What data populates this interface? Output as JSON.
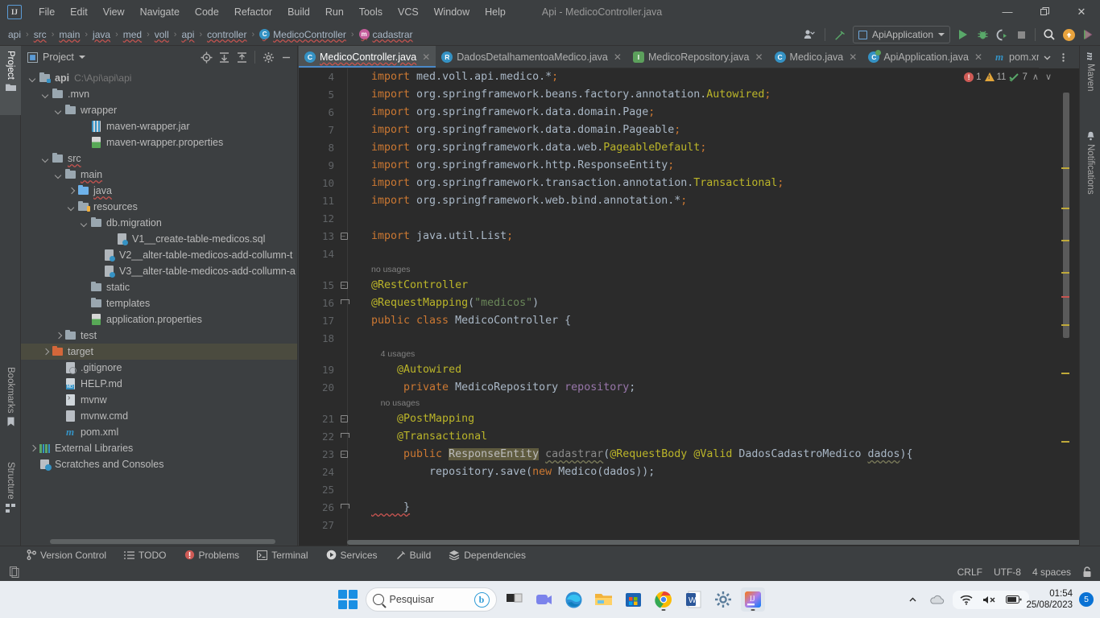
{
  "window": {
    "title": "Api - MedicoController.java",
    "logo": "IJ",
    "controls": {
      "minimize": "—",
      "maximize": "❐",
      "close": "✕"
    }
  },
  "menu": [
    {
      "label": "File"
    },
    {
      "label": "Edit"
    },
    {
      "label": "View"
    },
    {
      "label": "Navigate"
    },
    {
      "label": "Code"
    },
    {
      "label": "Refactor"
    },
    {
      "label": "Build"
    },
    {
      "label": "Run"
    },
    {
      "label": "Tools"
    },
    {
      "label": "VCS"
    },
    {
      "label": "Window"
    },
    {
      "label": "Help"
    }
  ],
  "breadcrumb": [
    {
      "label": "api",
      "icon": "none",
      "squiggle": false
    },
    {
      "label": "src",
      "icon": "none",
      "squiggle": true
    },
    {
      "label": "main",
      "icon": "none",
      "squiggle": true
    },
    {
      "label": "java",
      "icon": "none",
      "squiggle": true
    },
    {
      "label": "med",
      "icon": "none",
      "squiggle": true
    },
    {
      "label": "voll",
      "icon": "none",
      "squiggle": true
    },
    {
      "label": "api",
      "icon": "none",
      "squiggle": true
    },
    {
      "label": "controller",
      "icon": "none",
      "squiggle": true
    },
    {
      "label": "MedicoController",
      "icon": "class-icon",
      "squiggle": true
    },
    {
      "label": "cadastrar",
      "icon": "method-icon",
      "squiggle": true
    }
  ],
  "toolbar": {
    "run_config": "ApiApplication",
    "icons": [
      "user-settings-icon",
      "build-hammer-icon",
      "run-icon",
      "debug-icon",
      "run-with-coverage-icon",
      "stop-icon",
      "search-everywhere-icon",
      "update-project-icon",
      "ide-assistant-icon"
    ]
  },
  "left_strip": [
    {
      "label": "Project",
      "icon": "project-folder-icon",
      "active": true
    },
    {
      "label": "Bookmarks",
      "icon": "bookmark-icon",
      "active": false
    },
    {
      "label": "Structure",
      "icon": "structure-icon",
      "active": false
    }
  ],
  "right_strip": [
    {
      "label": "Maven",
      "icon": "maven-icon"
    },
    {
      "label": "Notifications",
      "icon": "bell-icon"
    }
  ],
  "project_panel": {
    "title": "Project",
    "tools": [
      "select-opened-file-icon",
      "expand-all-icon",
      "collapse-all-icon",
      "settings-gear-icon",
      "hide-panel-icon"
    ],
    "tree": [
      {
        "label": "api",
        "path": "C:\\Api\\api\\api",
        "depth": 0,
        "arrow": "d",
        "icon": "module-folder",
        "selected": false,
        "squiggle": false,
        "bold": true
      },
      {
        "label": ".mvn",
        "depth": 1,
        "arrow": "d",
        "icon": "folder",
        "selected": false
      },
      {
        "label": "wrapper",
        "depth": 2,
        "arrow": "d",
        "icon": "folder",
        "selected": false
      },
      {
        "label": "maven-wrapper.jar",
        "depth": 4,
        "arrow": "",
        "icon": "jar",
        "selected": false
      },
      {
        "label": "maven-wrapper.properties",
        "depth": 4,
        "arrow": "",
        "icon": "properties",
        "selected": false
      },
      {
        "label": "src",
        "depth": 1,
        "arrow": "d",
        "icon": "folder",
        "selected": false,
        "squiggle": true
      },
      {
        "label": "main",
        "depth": 2,
        "arrow": "d",
        "icon": "folder",
        "selected": false,
        "squiggle": true
      },
      {
        "label": "java",
        "depth": 3,
        "arrow": "r",
        "icon": "source-folder",
        "selected": false,
        "squiggle": true
      },
      {
        "label": "resources",
        "depth": 3,
        "arrow": "d",
        "icon": "resource-folder",
        "selected": false
      },
      {
        "label": "db.migration",
        "depth": 4,
        "arrow": "d",
        "icon": "folder",
        "selected": false
      },
      {
        "label": "V1__create-table-medicos.sql",
        "depth": 6,
        "arrow": "",
        "icon": "sql",
        "selected": false
      },
      {
        "label": "V2__alter-table-medicos-add-collumn-t",
        "depth": 5,
        "arrow": "",
        "icon": "sql",
        "selected": false
      },
      {
        "label": "V3__alter-table-medicos-add-collumn-a",
        "depth": 5,
        "arrow": "",
        "icon": "sql",
        "selected": false
      },
      {
        "label": "static",
        "depth": 4,
        "arrow": "",
        "icon": "folder",
        "selected": false
      },
      {
        "label": "templates",
        "depth": 4,
        "arrow": "",
        "icon": "folder",
        "selected": false
      },
      {
        "label": "application.properties",
        "depth": 4,
        "arrow": "",
        "icon": "properties",
        "selected": false
      },
      {
        "label": "test",
        "depth": 2,
        "arrow": "r",
        "icon": "folder",
        "selected": false
      },
      {
        "label": "target",
        "depth": 1,
        "arrow": "r",
        "icon": "target-folder",
        "selected": true
      },
      {
        "label": ".gitignore",
        "depth": 2,
        "arrow": "",
        "icon": "gitignore",
        "selected": false
      },
      {
        "label": "HELP.md",
        "depth": 2,
        "arrow": "",
        "icon": "markdown",
        "selected": false
      },
      {
        "label": "mvnw",
        "depth": 2,
        "arrow": "",
        "icon": "script",
        "selected": false
      },
      {
        "label": "mvnw.cmd",
        "depth": 2,
        "arrow": "",
        "icon": "file",
        "selected": false
      },
      {
        "label": "pom.xml",
        "depth": 2,
        "arrow": "",
        "icon": "maven-file",
        "selected": false
      },
      {
        "label": "External Libraries",
        "depth": 0,
        "arrow": "r",
        "icon": "libraries",
        "selected": false
      },
      {
        "label": "Scratches and Consoles",
        "depth": 0,
        "arrow": "",
        "icon": "scratches",
        "selected": false
      }
    ]
  },
  "editor_tabs": [
    {
      "label": "MedicoController.java",
      "icon": "class-file-icon",
      "active": true,
      "squiggle": true
    },
    {
      "label": "DadosDetalhamentoaMedico.java",
      "icon": "record-file-icon",
      "active": false,
      "squiggle": false
    },
    {
      "label": "MedicoRepository.java",
      "icon": "interface-file-icon",
      "active": false,
      "squiggle": false
    },
    {
      "label": "Medico.java",
      "icon": "class-file-icon",
      "active": false,
      "squiggle": false
    },
    {
      "label": "ApiApplication.java",
      "icon": "spring-file-icon",
      "active": false,
      "squiggle": false
    },
    {
      "label": "pom.xml (a",
      "icon": "maven-file-icon",
      "active": false,
      "squiggle": false
    }
  ],
  "inspections": {
    "errors": "1",
    "warnings": "11",
    "weak_warnings": "7",
    "up_label": "∧",
    "down_label": "∨"
  },
  "code": {
    "lines": [
      {
        "num": "4",
        "fold": "",
        "hint": "",
        "tokens": [
          {
            "t": "import ",
            "c": "kw"
          },
          {
            "t": "med.voll.api.medico.",
            "c": "ident"
          },
          {
            "t": "*",
            "c": "ident"
          },
          {
            "t": ";",
            "c": "kw"
          }
        ]
      },
      {
        "num": "5",
        "fold": "",
        "hint": "",
        "tokens": [
          {
            "t": "import ",
            "c": "kw"
          },
          {
            "t": "org.springframework.beans.factory.annotation.",
            "c": "ident"
          },
          {
            "t": "Autowired",
            "c": "anno"
          },
          {
            "t": ";",
            "c": "kw"
          }
        ]
      },
      {
        "num": "6",
        "fold": "",
        "hint": "",
        "tokens": [
          {
            "t": "import ",
            "c": "kw"
          },
          {
            "t": "org.springframework.data.domain.",
            "c": "ident"
          },
          {
            "t": "Page",
            "c": "cls2"
          },
          {
            "t": ";",
            "c": "kw"
          }
        ]
      },
      {
        "num": "7",
        "fold": "",
        "hint": "",
        "tokens": [
          {
            "t": "import ",
            "c": "kw"
          },
          {
            "t": "org.springframework.data.domain.",
            "c": "ident"
          },
          {
            "t": "Pageable",
            "c": "cls2"
          },
          {
            "t": ";",
            "c": "kw"
          }
        ]
      },
      {
        "num": "8",
        "fold": "",
        "hint": "",
        "tokens": [
          {
            "t": "import ",
            "c": "kw"
          },
          {
            "t": "org.springframework.data.web.",
            "c": "ident"
          },
          {
            "t": "PageableDefault",
            "c": "anno"
          },
          {
            "t": ";",
            "c": "kw"
          }
        ]
      },
      {
        "num": "9",
        "fold": "",
        "hint": "",
        "tokens": [
          {
            "t": "import ",
            "c": "kw"
          },
          {
            "t": "org.springframework.http.",
            "c": "ident"
          },
          {
            "t": "ResponseEntity",
            "c": "cls2"
          },
          {
            "t": ";",
            "c": "kw"
          }
        ]
      },
      {
        "num": "10",
        "fold": "",
        "hint": "",
        "tokens": [
          {
            "t": "import ",
            "c": "kw"
          },
          {
            "t": "org.springframework.transaction.annotation.",
            "c": "ident"
          },
          {
            "t": "Transactional",
            "c": "anno"
          },
          {
            "t": ";",
            "c": "kw"
          }
        ]
      },
      {
        "num": "11",
        "fold": "",
        "hint": "",
        "tokens": [
          {
            "t": "import ",
            "c": "kw"
          },
          {
            "t": "org.springframework.web.bind.annotation.",
            "c": "ident"
          },
          {
            "t": "*",
            "c": "ident"
          },
          {
            "t": ";",
            "c": "kw"
          }
        ]
      },
      {
        "num": "12",
        "fold": "",
        "hint": "",
        "tokens": []
      },
      {
        "num": "13",
        "fold": "start",
        "hint": "",
        "tokens": [
          {
            "t": "import ",
            "c": "kw"
          },
          {
            "t": "java.util.",
            "c": "ident"
          },
          {
            "t": "List",
            "c": "cls2"
          },
          {
            "t": ";",
            "c": "kw"
          }
        ]
      },
      {
        "num": "14",
        "fold": "",
        "hint": "",
        "tokens": []
      },
      {
        "num": "15",
        "fold": "start",
        "hint": "no usages",
        "tokens": [
          {
            "t": "@RestController",
            "c": "anno"
          }
        ]
      },
      {
        "num": "16",
        "fold": "end",
        "hint": "",
        "tokens": [
          {
            "t": "@RequestMapping",
            "c": "anno"
          },
          {
            "t": "(",
            "c": "ident"
          },
          {
            "t": "\"medicos\"",
            "c": "str"
          },
          {
            "t": ")",
            "c": "ident"
          }
        ]
      },
      {
        "num": "17",
        "fold": "",
        "hint": "",
        "tokens": [
          {
            "t": "public class ",
            "c": "kw"
          },
          {
            "t": "MedicoController ",
            "c": "ident"
          },
          {
            "t": "{",
            "c": "ident"
          }
        ]
      },
      {
        "num": "18",
        "fold": "",
        "hint": "",
        "tokens": []
      },
      {
        "num": "19",
        "fold": "",
        "hint": "    4 usages",
        "tokens": [
          {
            "t": "    @Autowired",
            "c": "anno"
          }
        ]
      },
      {
        "num": "20",
        "fold": "",
        "hint": "",
        "tokens": [
          {
            "t": "     private ",
            "c": "kw"
          },
          {
            "t": "MedicoRepository ",
            "c": "ident"
          },
          {
            "t": "repository",
            "c": "fld"
          },
          {
            "t": ";",
            "c": "ident"
          }
        ]
      },
      {
        "num": "21",
        "fold": "start",
        "hint": "    no usages",
        "tokens": [
          {
            "t": "    @PostMapping",
            "c": "anno"
          }
        ]
      },
      {
        "num": "22",
        "fold": "end",
        "hint": "",
        "tokens": [
          {
            "t": "    @Transactional",
            "c": "anno"
          }
        ]
      },
      {
        "num": "23",
        "fold": "start",
        "hint": "",
        "tokens": [
          {
            "t": "     public ",
            "c": "kw"
          },
          {
            "t": "ResponseEntity",
            "c": "hl-sel"
          },
          {
            "t": " ",
            "c": "ident"
          },
          {
            "t": "cadastrar",
            "c": "stat sq-gray"
          },
          {
            "t": "(",
            "c": "ident"
          },
          {
            "t": "@RequestBody @Valid",
            "c": "anno"
          },
          {
            "t": " DadosCadastroMedico ",
            "c": "ident"
          },
          {
            "t": "dados",
            "c": "ident sq-gray"
          },
          {
            "t": "){",
            "c": "ident"
          }
        ]
      },
      {
        "num": "24",
        "fold": "",
        "hint": "",
        "tokens": [
          {
            "t": "         repository.",
            "c": "ident"
          },
          {
            "t": "save",
            "c": "ident"
          },
          {
            "t": "(",
            "c": "ident"
          },
          {
            "t": "new ",
            "c": "kw"
          },
          {
            "t": "Medico(dados));",
            "c": "ident"
          }
        ]
      },
      {
        "num": "25",
        "fold": "",
        "hint": "",
        "tokens": []
      },
      {
        "num": "26",
        "fold": "end",
        "hint": "",
        "tokens": [
          {
            "t": "     }",
            "c": "ident sq-red"
          }
        ]
      },
      {
        "num": "27",
        "fold": "",
        "hint": "",
        "tokens": []
      }
    ]
  },
  "bottom_bar": [
    {
      "label": "Version Control",
      "icon": "branch-icon"
    },
    {
      "label": "TODO",
      "icon": "todo-list-icon"
    },
    {
      "label": "Problems",
      "icon": "problems-error-icon"
    },
    {
      "label": "Terminal",
      "icon": "terminal-icon"
    },
    {
      "label": "Services",
      "icon": "services-play-icon"
    },
    {
      "label": "Build",
      "icon": "build-hammer-icon"
    },
    {
      "label": "Dependencies",
      "icon": "dependencies-layers-icon"
    }
  ],
  "status_bar": {
    "left_icon": "copy-document-icon",
    "line_separator": "CRLF",
    "encoding": "UTF-8",
    "indent": "4 spaces",
    "lock": "read-only-lock-icon"
  },
  "taskbar": {
    "start": "windows-start-icon",
    "search_placeholder": "Pesquisar",
    "bing_icon": "bing-chat-icon",
    "apps": [
      {
        "name": "task-view-icon",
        "running": false
      },
      {
        "name": "teams-icon",
        "running": false
      },
      {
        "name": "edge-icon",
        "running": false
      },
      {
        "name": "file-explorer-icon",
        "running": false
      },
      {
        "name": "microsoft-store-icon",
        "running": false
      },
      {
        "name": "chrome-icon",
        "running": true
      },
      {
        "name": "word-icon",
        "running": false
      },
      {
        "name": "settings-icon",
        "running": false
      },
      {
        "name": "intellij-idea-icon",
        "running": true
      }
    ],
    "tray": {
      "chevron": "show-hidden-icons",
      "cloud": "onedrive-icon",
      "wifi": "wifi-icon",
      "volume": "volume-muted-icon",
      "battery": "battery-icon"
    },
    "clock": {
      "time": "01:54",
      "date": "25/08/2023"
    },
    "notification_count": "5"
  }
}
